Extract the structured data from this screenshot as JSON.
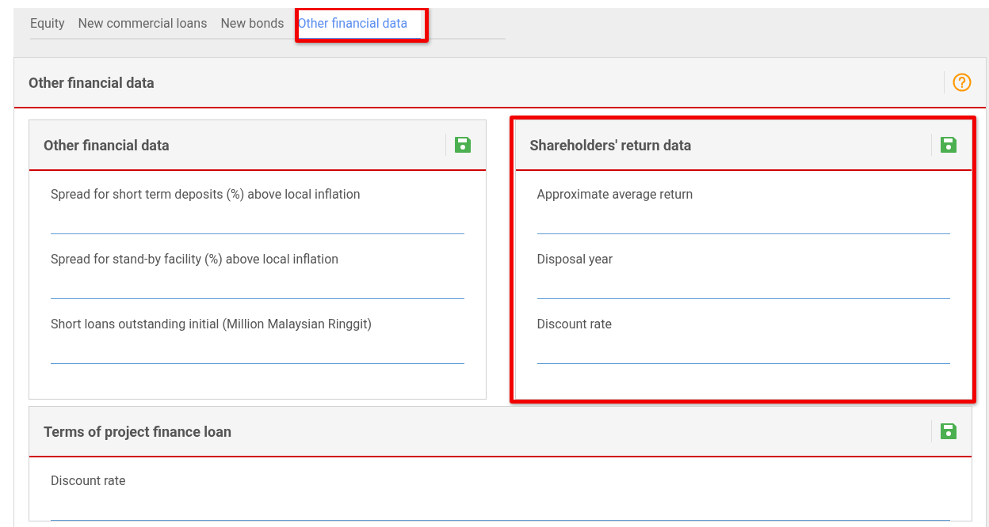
{
  "tabs": [
    {
      "label": "Equity",
      "selected": false,
      "highlighted": false
    },
    {
      "label": "New commercial loans",
      "selected": false,
      "highlighted": false
    },
    {
      "label": "New bonds",
      "selected": false,
      "highlighted": false
    },
    {
      "label": "Other financial data",
      "selected": true,
      "highlighted": true
    }
  ],
  "card": {
    "title": "Other financial data"
  },
  "panels": [
    {
      "kind": "half",
      "title": "Other financial data",
      "highlighted": false,
      "fields": [
        {
          "label": "Spread for short term deposits (%) above local inflation"
        },
        {
          "label": "Spread for stand-by facility (%) above local inflation"
        },
        {
          "label": "Short loans outstanding initial (Million Malaysian Ringgit)"
        }
      ]
    },
    {
      "kind": "half",
      "title": "Shareholders' return data",
      "highlighted": true,
      "fields": [
        {
          "label": "Approximate average return"
        },
        {
          "label": "Disposal year"
        },
        {
          "label": "Discount rate"
        }
      ]
    },
    {
      "kind": "full",
      "title": "Terms of project finance loan",
      "highlighted": false,
      "fields": [
        {
          "label": "Discount rate"
        }
      ]
    }
  ]
}
